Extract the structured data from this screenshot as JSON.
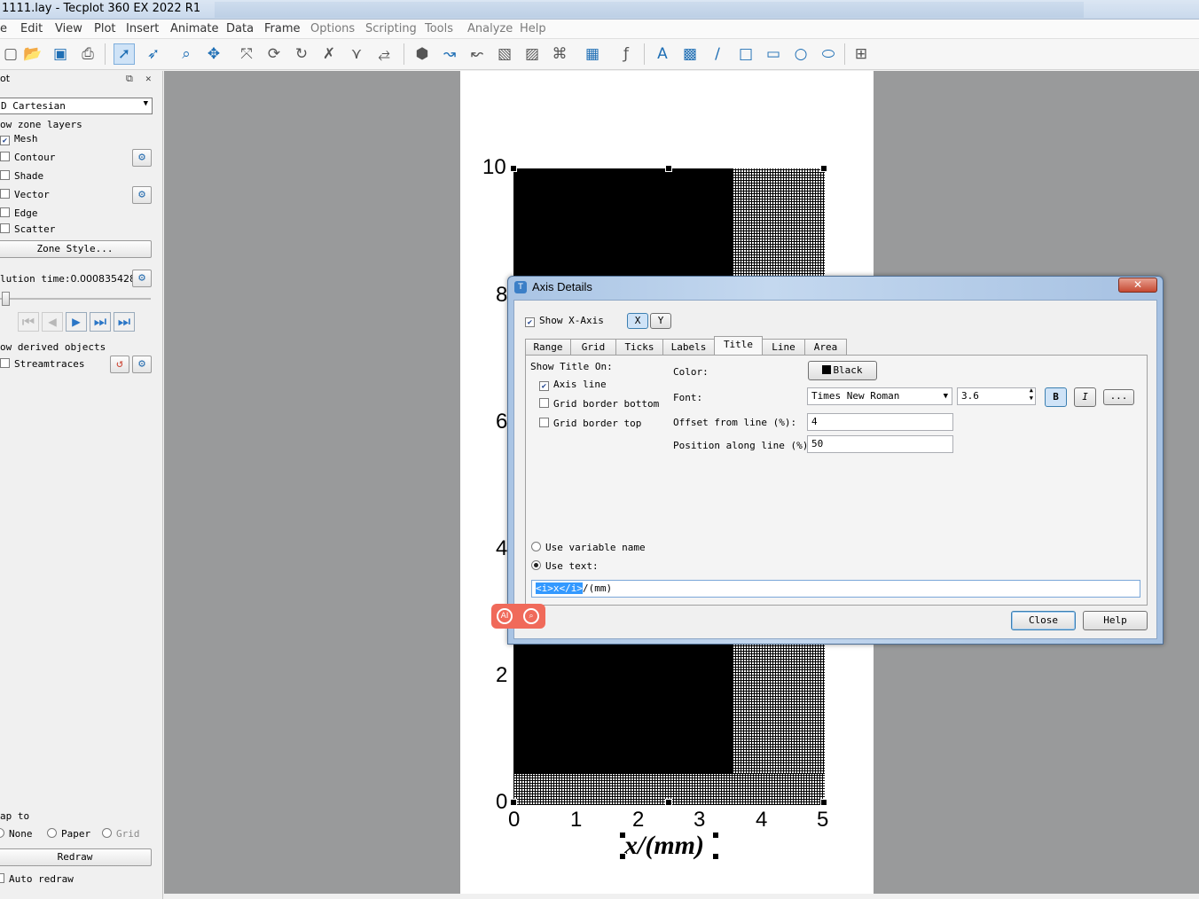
{
  "window": {
    "title": "1111.lay - Tecplot 360 EX 2022 R1"
  },
  "menu": [
    "e",
    "Edit",
    "View",
    "Plot",
    "Insert",
    "Animate",
    "Data",
    "Frame",
    "Options",
    "Scripting",
    "Tools",
    "Analyze",
    "Help"
  ],
  "sidebar": {
    "header": "ot",
    "plot_type": "D Cartesian",
    "zone_layers_label": "ow zone layers",
    "layers": [
      {
        "label": "Mesh",
        "checked": true
      },
      {
        "label": "Contour",
        "checked": false
      },
      {
        "label": "Shade",
        "checked": false
      },
      {
        "label": "Vector",
        "checked": false
      },
      {
        "label": "Edge",
        "checked": false
      },
      {
        "label": "Scatter",
        "checked": false
      }
    ],
    "zone_style_label": "Zone Style...",
    "solution_time_label": "lution time:",
    "solution_time_value": "0.000835428",
    "derived_label": "ow derived objects",
    "streamtraces_label": "Streamtraces",
    "snap_label": "ap to",
    "snap_options": [
      "None",
      "Paper",
      "Grid"
    ],
    "redraw_label": "Redraw",
    "auto_redraw_label": "Auto redraw"
  },
  "plot": {
    "y_ticks": [
      "10",
      "8",
      "6",
      "4",
      "2",
      "0"
    ],
    "x_ticks": [
      "0",
      "1",
      "2",
      "3",
      "4",
      "5"
    ],
    "x_title": "x/(mm)"
  },
  "dialog": {
    "title": "Axis Details",
    "close_x": "✕",
    "show_axis_label": "Show X-Axis",
    "axis_x": "X",
    "axis_y": "Y",
    "tabs": [
      "Range",
      "Grid",
      "Ticks",
      "Labels",
      "Title",
      "Line",
      "Area"
    ],
    "selected_tab": "Title",
    "show_title_on_label": "Show Title On:",
    "show_on": [
      {
        "label": "Axis line",
        "checked": true
      },
      {
        "label": "Grid border bottom",
        "checked": false
      },
      {
        "label": "Grid border top",
        "checked": false
      }
    ],
    "color_label": "Color:",
    "color_value": "Black",
    "font_label": "Font:",
    "font_value": "Times New Roman",
    "font_size": "3.6",
    "bold_label": "B",
    "italic_label": "I",
    "more_label": "...",
    "offset_label": "Offset from line (%):",
    "offset_value": "4",
    "position_label": "Position along line (%):",
    "position_value": "50",
    "use_variable_label": "Use variable name",
    "use_text_label": "Use text:",
    "text_selected": "<i>x</i>",
    "text_rest": "/(mm)",
    "close_label": "Close",
    "help_label": "Help"
  },
  "colors": {
    "accent": "#3399ff",
    "canvas_bg": "#999a9b",
    "close_button": "#c64a33"
  }
}
